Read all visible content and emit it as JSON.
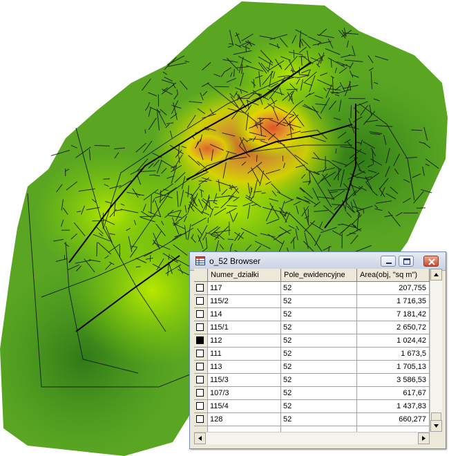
{
  "window": {
    "title": "o_52 Browser",
    "minimize_label": "_",
    "maximize_label": "□",
    "close_label": "×"
  },
  "table": {
    "columns": [
      "Numer_działki",
      "Pole_ewidencyjne",
      "Area(obj, \"sq m\")"
    ],
    "rows": [
      {
        "selected": false,
        "numer": "117",
        "pole": "52",
        "area": "207,755"
      },
      {
        "selected": false,
        "numer": "115/2",
        "pole": "52",
        "area": "1 716,35"
      },
      {
        "selected": false,
        "numer": "114",
        "pole": "52",
        "area": "7 181,42"
      },
      {
        "selected": false,
        "numer": "115/1",
        "pole": "52",
        "area": "2 650,72"
      },
      {
        "selected": true,
        "numer": "112",
        "pole": "52",
        "area": "1 024,42"
      },
      {
        "selected": false,
        "numer": "111",
        "pole": "52",
        "area": "1 673,5"
      },
      {
        "selected": false,
        "numer": "113",
        "pole": "52",
        "area": "1 705,13"
      },
      {
        "selected": false,
        "numer": "115/3",
        "pole": "52",
        "area": "3 586,53"
      },
      {
        "selected": false,
        "numer": "107/3",
        "pole": "52",
        "area": "617,67"
      },
      {
        "selected": false,
        "numer": "115/4",
        "pole": "52",
        "area": "1 437,83"
      },
      {
        "selected": false,
        "numer": "128",
        "pole": "52",
        "area": "660,277"
      }
    ]
  },
  "colors": {
    "map_low": "#3e8f1e",
    "map_mid": "#7fd000",
    "map_high": "#e5e000",
    "map_peak": "#e0522a",
    "parcel_lines": "#111111"
  }
}
